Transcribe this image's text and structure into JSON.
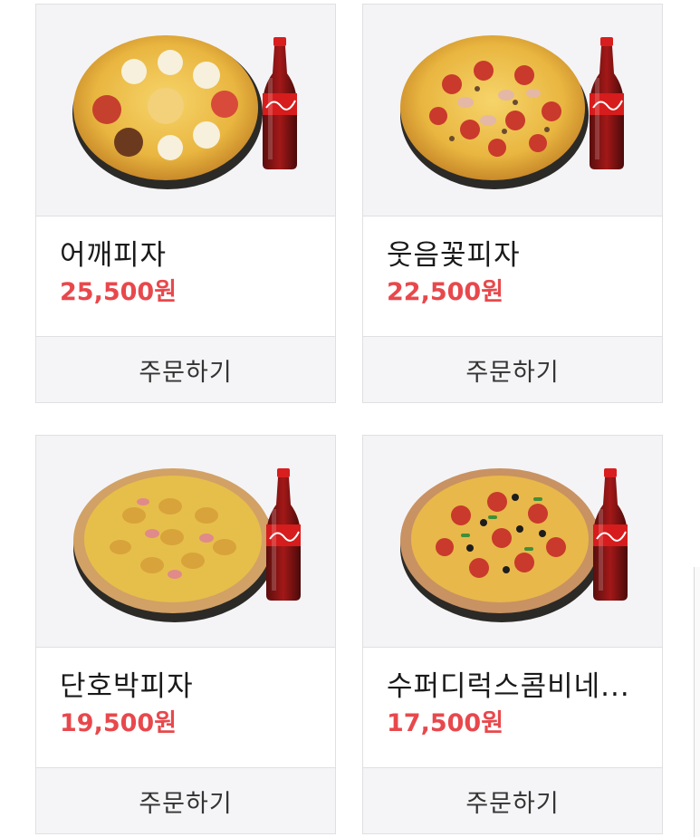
{
  "products": [
    {
      "name": "어깨피자",
      "price": "25,500원",
      "order_label": "주문하기"
    },
    {
      "name": "웃음꽃피자",
      "price": "22,500원",
      "order_label": "주문하기"
    },
    {
      "name": "단호박피자",
      "price": "19,500원",
      "order_label": "주문하기"
    },
    {
      "name": "수퍼디럭스콤비네...",
      "price": "17,500원",
      "order_label": "주문하기"
    }
  ],
  "colors": {
    "price": "#e8484c",
    "button_bg": "#f5f5f7",
    "border": "#e0e0e3"
  },
  "icons": [
    "pizza-image",
    "cola-bottle-image"
  ]
}
